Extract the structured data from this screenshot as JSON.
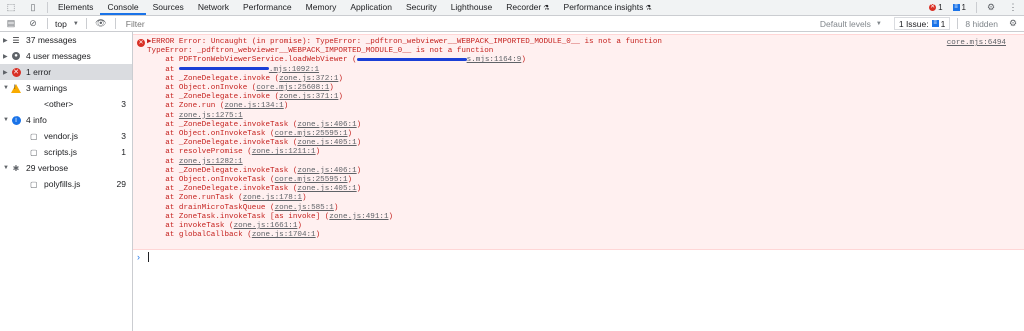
{
  "tabs": [
    "Elements",
    "Console",
    "Sources",
    "Network",
    "Performance",
    "Memory",
    "Application",
    "Security",
    "Lighthouse",
    "Recorder",
    "Performance insights"
  ],
  "active_tab": "Console",
  "badges": {
    "errors": "1",
    "messages": "1"
  },
  "toolbar": {
    "context": "top",
    "filter_placeholder": "Filter",
    "levels": "Default levels",
    "issues": "1 Issue:",
    "issues_count": "1",
    "hidden": "8 hidden"
  },
  "sidebar": {
    "items": [
      {
        "label": "37 messages",
        "icon": "list-icon"
      },
      {
        "label": "4 user messages",
        "icon": "user-icon"
      },
      {
        "label": "1 error",
        "icon": "error-icon"
      },
      {
        "label": "3 warnings",
        "icon": "warning-icon"
      },
      {
        "label": "<other>",
        "count": "3"
      },
      {
        "label": "4 info",
        "icon": "info-icon"
      },
      {
        "label": "vendor.js",
        "count": "3"
      },
      {
        "label": "scripts.js",
        "count": "1"
      },
      {
        "label": "29 verbose",
        "icon": "verbose-icon"
      },
      {
        "label": "polyfills.js",
        "count": "29"
      }
    ]
  },
  "console": {
    "source": "core.mjs:6494",
    "lines": [
      {
        "text": "▶ERROR Error: Uncaught (in promise): TypeError: _pdftron_webviewer__WEBPACK_IMPORTED_MODULE_0__ is not a function"
      },
      {
        "text": "TypeError: _pdftron_webviewer__WEBPACK_IMPORTED_MODULE_0__ is not a function"
      },
      {
        "text": "    at PDFTronWebViewerService.loadWebViewer (",
        "link": "s.mjs:1164:9",
        "close": ")"
      },
      {
        "text": "    at ",
        "link": ".mjs:1092:1",
        "close": ""
      },
      {
        "text": "    at _ZoneDelegate.invoke (",
        "link": "zone.js:372:1",
        "close": ")"
      },
      {
        "text": "    at Object.onInvoke (",
        "link": "core.mjs:25608:1",
        "close": ")"
      },
      {
        "text": "    at _ZoneDelegate.invoke (",
        "link": "zone.js:371:1",
        "close": ")"
      },
      {
        "text": "    at Zone.run (",
        "link": "zone.js:134:1",
        "close": ")"
      },
      {
        "text": "    at ",
        "link": "zone.js:1275:1",
        "close": ""
      },
      {
        "text": "    at _ZoneDelegate.invokeTask (",
        "link": "zone.js:406:1",
        "close": ")"
      },
      {
        "text": "    at Object.onInvokeTask (",
        "link": "core.mjs:25595:1",
        "close": ")"
      },
      {
        "text": "    at _ZoneDelegate.invokeTask (",
        "link": "zone.js:405:1",
        "close": ")"
      },
      {
        "text": "    at resolvePromise (",
        "link": "zone.js:1211:1",
        "close": ")"
      },
      {
        "text": "    at ",
        "link": "zone.js:1282:1",
        "close": ""
      },
      {
        "text": "    at _ZoneDelegate.invokeTask (",
        "link": "zone.js:406:1",
        "close": ")"
      },
      {
        "text": "    at Object.onInvokeTask (",
        "link": "core.mjs:25595:1",
        "close": ")"
      },
      {
        "text": "    at _ZoneDelegate.invokeTask (",
        "link": "zone.js:405:1",
        "close": ")"
      },
      {
        "text": "    at Zone.runTask (",
        "link": "zone.js:178:1",
        "close": ")"
      },
      {
        "text": "    at drainMicroTaskQueue (",
        "link": "zone.js:585:1",
        "close": ")"
      },
      {
        "text": "    at ZoneTask.invokeTask [as invoke] (",
        "link": "zone.js:491:1",
        "close": ")"
      },
      {
        "text": "    at invokeTask (",
        "link": "zone.js:1661:1",
        "close": ")"
      },
      {
        "text": "    at globalCallback (",
        "link": "zone.js:1704:1",
        "close": ")"
      }
    ],
    "prompt": "›"
  },
  "colors": {
    "error": "#c5221f",
    "error_bg": "#fff0f0",
    "accent": "#1a73e8",
    "warning": "#f9ab00"
  }
}
